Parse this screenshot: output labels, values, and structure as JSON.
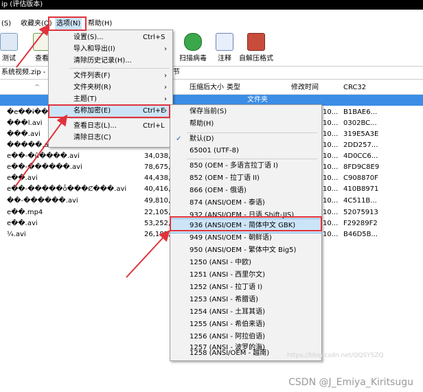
{
  "window": {
    "title": "ip (评估版本)"
  },
  "menubar": [
    {
      "label": "(S)"
    },
    {
      "label": "收藏夹(O)"
    },
    {
      "label": "选项(N)"
    },
    {
      "label": "帮助(H)"
    }
  ],
  "toolbar": [
    {
      "label": "测试",
      "icon": "test-icon"
    },
    {
      "label": "查看",
      "icon": "view-icon"
    },
    {
      "label": "扫描病毒",
      "icon": "virus-scan-icon"
    },
    {
      "label": "注释",
      "icon": "comment-icon"
    },
    {
      "label": "自解压格式",
      "icon": "sfx-icon"
    }
  ],
  "address": {
    "left": "系统视频.zip - Z",
    "right": "节"
  },
  "columns": {
    "packed": "压缩后大小",
    "type": "类型",
    "modified": "修改时间",
    "crc": "CRC32"
  },
  "folder_row": {
    "type": "文件夹"
  },
  "files": [
    {
      "name": "�e��ɨ��'.mp4",
      "packed": "",
      "modified": "10...",
      "crc": "B1BAE6..."
    },
    {
      "name": "���l.avi",
      "packed": "",
      "modified": "10...",
      "crc": "0302BC..."
    },
    {
      "name": "���.avi",
      "packed": "",
      "modified": "10...",
      "crc": "319E5A3E"
    },
    {
      "name": "�����.avi",
      "packed": "37,293,2",
      "modified": "10...",
      "crc": "2DD257..."
    },
    {
      "name": "e��-�û����.avi",
      "packed": "34,038,2",
      "modified": "10...",
      "crc": "4D0CC6..."
    },
    {
      "name": "e��-������.avi",
      "packed": "78,675,9",
      "modified": "10...",
      "crc": "8FD9C8E9"
    },
    {
      "name": "e��.avi",
      "packed": "44,438,0",
      "modified": "10...",
      "crc": "C908870F"
    },
    {
      "name": "e��-�����ȱ���Ȼ���.avi",
      "packed": "40,416,7",
      "modified": "10...",
      "crc": "410B8971"
    },
    {
      "name": "��-������.avi",
      "packed": "49,810,9",
      "modified": "10...",
      "crc": "4C511B..."
    },
    {
      "name": "e��.mp4",
      "packed": "22,105,8",
      "modified": "10...",
      "crc": "52075913"
    },
    {
      "name": "e��.avi",
      "packed": "53,252,0",
      "modified": "10...",
      "crc": "F29289F2"
    },
    {
      "name": "¼.avi",
      "packed": "26,187,2",
      "modified": "10...",
      "crc": "B46D5B..."
    }
  ],
  "options_menu": [
    {
      "label": "设置(S)...",
      "shortcut": "Ctrl+S",
      "submenu": false
    },
    {
      "label": "导入和导出(I)",
      "shortcut": "",
      "submenu": true
    },
    {
      "label": "清除历史记录(H)...",
      "shortcut": "",
      "submenu": false
    },
    {
      "label": "文件列表(F)",
      "shortcut": "",
      "submenu": true
    },
    {
      "label": "文件夹树(R)",
      "shortcut": "",
      "submenu": true
    },
    {
      "label": "主题(T)",
      "shortcut": "",
      "submenu": true
    },
    {
      "label": "名称加密(E)",
      "shortcut": "Ctrl+E",
      "submenu": true
    },
    {
      "label": "查看日志(L)...",
      "shortcut": "Ctrl+L",
      "submenu": false
    },
    {
      "label": "清除日志(C)",
      "shortcut": "",
      "submenu": false
    }
  ],
  "encoding_menu": [
    {
      "label": "保存当前(S)"
    },
    {
      "label": "帮助(H)"
    },
    {
      "label": "默认(D)",
      "checked": true
    },
    {
      "label": "65001 (UTF-8)"
    },
    {
      "label": "850   (OEM - 多语言拉丁语 I)"
    },
    {
      "label": "852   (OEM - 拉丁语 II)"
    },
    {
      "label": "866   (OEM - 俄语)"
    },
    {
      "label": "874   (ANSI/OEM - 泰语)"
    },
    {
      "label": "932   (ANSI/OEM - 日语 Shift-JIS)"
    },
    {
      "label": "936   (ANSI/OEM - 简体中文 GBK)",
      "highlighted": true
    },
    {
      "label": "949   (ANSI/OEM - 朝鲜语)"
    },
    {
      "label": "950   (ANSI/OEM - 繁体中文 Big5)"
    },
    {
      "label": "1250  (ANSI - 中欧)"
    },
    {
      "label": "1251  (ANSI - 西里尔文)"
    },
    {
      "label": "1252  (ANSI - 拉丁语 I)"
    },
    {
      "label": "1253  (ANSI - 希腊语)"
    },
    {
      "label": "1254  (ANSI - 土耳其语)"
    },
    {
      "label": "1255  (ANSI - 希伯来语)"
    },
    {
      "label": "1256  (ANSI - 阿拉伯语)"
    },
    {
      "label": "1257  (ANSI - 波罗的海)"
    },
    {
      "label": "1258  (ANSI/OEM - 越南)"
    }
  ],
  "watermark": "CSDN @J_Emiya_Kiritsugu",
  "faint_watermark": "https://blog.csdn.net/QQSYSZQ",
  "colors": {
    "highlight": "#cce4f7",
    "highlight_border": "#7ab6e6",
    "annotation": "#e0323c",
    "folder_row": "#3c8de6"
  }
}
